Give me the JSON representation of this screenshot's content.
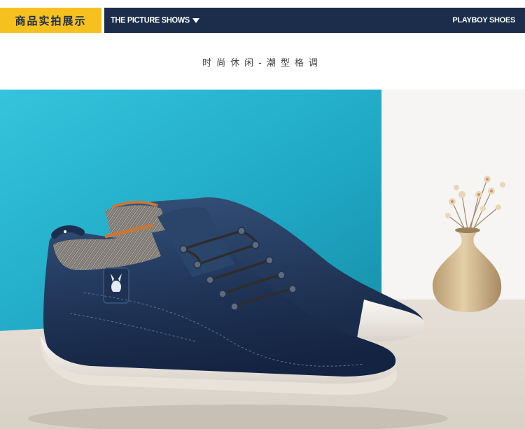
{
  "header": {
    "tag_label": "商品实拍展示",
    "title": "THE PICTURE SHOWS",
    "brand": "PLAYBOY SHOES"
  },
  "subtitle": "时尚休闲-潮型格调",
  "photo": {
    "icon": "playboy-bunny-logo"
  },
  "colors": {
    "header_bg": "#1b2d4a",
    "tag_bg": "#f6c11f",
    "backdrop_blue": "#2bb6cf",
    "shoe_leather": "#22365a",
    "sole": "#f0ece6"
  }
}
